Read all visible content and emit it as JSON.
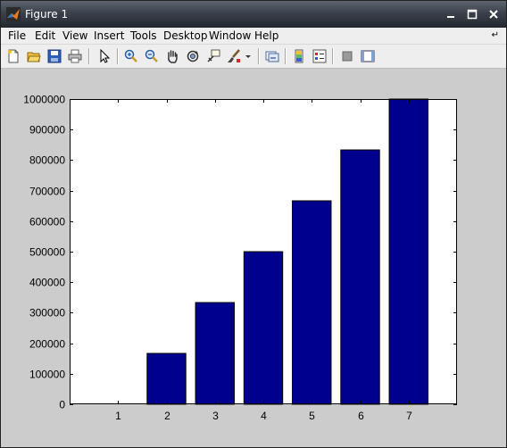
{
  "window": {
    "title": "Figure 1"
  },
  "menu": {
    "items": [
      "File",
      "Edit",
      "View",
      "Insert",
      "Tools",
      "Desktop",
      "Window",
      "Help"
    ]
  },
  "toolbar": {
    "icons": [
      "new-figure-icon",
      "open-file-icon",
      "save-icon",
      "print-icon",
      "select-arrow-icon",
      "zoom-in-icon",
      "zoom-out-icon",
      "pan-hand-icon",
      "rotate-3d-icon",
      "data-cursor-icon",
      "brush-icon",
      "brush-dropdown-icon",
      "link-plot-icon",
      "colorbar-icon",
      "legend-icon",
      "hide-plot-tools-icon",
      "show-plot-tools-icon"
    ]
  },
  "colors": {
    "bar": "#00008f",
    "plot_bg": "#ffffff",
    "figure_bg": "#cccccc"
  },
  "chart_data": {
    "type": "bar",
    "categories": [
      "1",
      "2",
      "3",
      "4",
      "5",
      "6",
      "7"
    ],
    "x": [
      1,
      2,
      3,
      4,
      5,
      6,
      7
    ],
    "values": [
      0,
      166667,
      333333,
      500000,
      666667,
      833333,
      1000000
    ],
    "ylim": [
      0,
      1000000
    ],
    "xlim": [
      0,
      8
    ],
    "yticks": [
      0,
      100000,
      200000,
      300000,
      400000,
      500000,
      600000,
      700000,
      800000,
      900000,
      1000000
    ],
    "ytick_labels": [
      "0",
      "100000",
      "200000",
      "300000",
      "400000",
      "500000",
      "600000",
      "700000",
      "800000",
      "900000",
      "1000000"
    ],
    "xtick_labels": [
      "1",
      "2",
      "3",
      "4",
      "5",
      "6",
      "7"
    ],
    "title": "",
    "xlabel": "",
    "ylabel": "",
    "grid": false
  }
}
